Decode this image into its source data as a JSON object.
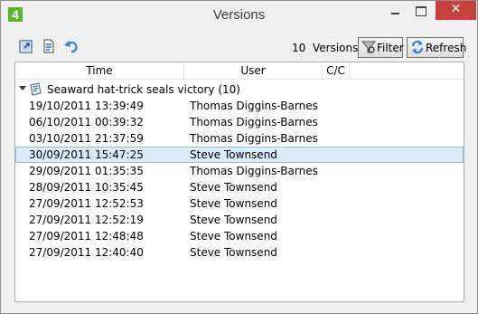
{
  "window": {
    "title": "Versions",
    "app_icon_text": "4",
    "controls": {
      "minimize_icon": "minimize-icon",
      "maximize_icon": "maximize-icon",
      "close_glyph": "✕",
      "close_color": "#c7403a"
    }
  },
  "toolbar": {
    "icons": [
      "open-external-icon",
      "file-compare-icon",
      "undo-icon"
    ],
    "count": "10",
    "count_label": "Versions",
    "filter_label": "Filter",
    "refresh_label": "Refresh"
  },
  "grid": {
    "columns": [
      "Time",
      "User",
      "C/C"
    ],
    "group": {
      "label": "Seaward hat-trick seals victory (10)",
      "icon": "document-icon"
    },
    "selection_color": "#d9ecfa",
    "rows": [
      {
        "time": "19/10/2011 13:39:49",
        "user": "Thomas Diggins-Barnes"
      },
      {
        "time": "06/10/2011 00:39:32",
        "user": "Thomas Diggins-Barnes"
      },
      {
        "time": "03/10/2011 21:37:59",
        "user": "Thomas Diggins-Barnes"
      },
      {
        "time": "30/09/2011 15:47:25",
        "user": "Steve Townsend",
        "selected": true
      },
      {
        "time": "29/09/2011 01:35:35",
        "user": "Thomas Diggins-Barnes"
      },
      {
        "time": "28/09/2011 10:35:45",
        "user": "Steve Townsend"
      },
      {
        "time": "27/09/2011 12:52:53",
        "user": "Steve Townsend"
      },
      {
        "time": "27/09/2011 12:52:19",
        "user": "Steve Townsend"
      },
      {
        "time": "27/09/2011 12:48:48",
        "user": "Steve Townsend"
      },
      {
        "time": "27/09/2011 12:40:40",
        "user": "Steve Townsend"
      }
    ]
  }
}
